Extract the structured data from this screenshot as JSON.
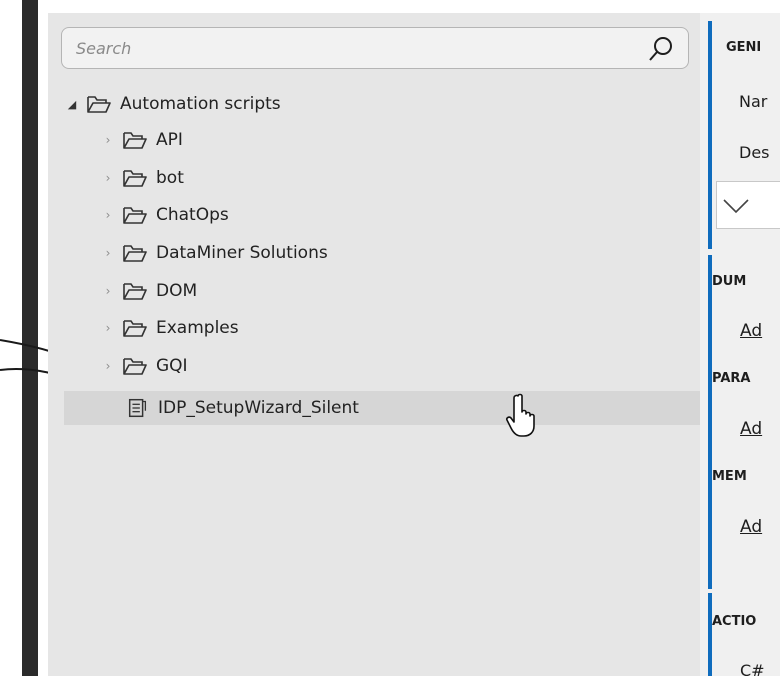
{
  "search": {
    "placeholder": "Search"
  },
  "tree": {
    "root": {
      "label": "Automation scripts",
      "expander": "◢",
      "icon": "folder-open-icon"
    },
    "children": [
      {
        "label": "API",
        "expander": "›",
        "icon": "folder-icon"
      },
      {
        "label": "bot",
        "expander": "›",
        "icon": "folder-icon"
      },
      {
        "label": "ChatOps",
        "expander": "›",
        "icon": "folder-icon"
      },
      {
        "label": "DataMiner Solutions",
        "expander": "›",
        "icon": "folder-icon"
      },
      {
        "label": "DOM",
        "expander": "›",
        "icon": "folder-icon"
      },
      {
        "label": "Examples",
        "expander": "›",
        "icon": "folder-icon"
      },
      {
        "label": "GQI",
        "expander": "›",
        "icon": "folder-icon"
      }
    ],
    "script_item": {
      "label": "IDP_SetupWizard_Silent",
      "icon": "script-icon"
    }
  },
  "details": {
    "general": {
      "title": "GENI",
      "name_label": "Nar",
      "description_label": "Des"
    },
    "dummies": {
      "title": "DUM",
      "add_link": "Ad"
    },
    "parameters": {
      "title": "PARA",
      "add_link": "Ad"
    },
    "memory": {
      "title": "MEM",
      "add_link": "Ad"
    },
    "actions": {
      "title": "ACTIO",
      "first_action": "C#"
    }
  },
  "colors": {
    "accent": "#0f6cbd",
    "panel_bg": "#e6e6e6",
    "dark_bar": "#2b2b2b"
  }
}
